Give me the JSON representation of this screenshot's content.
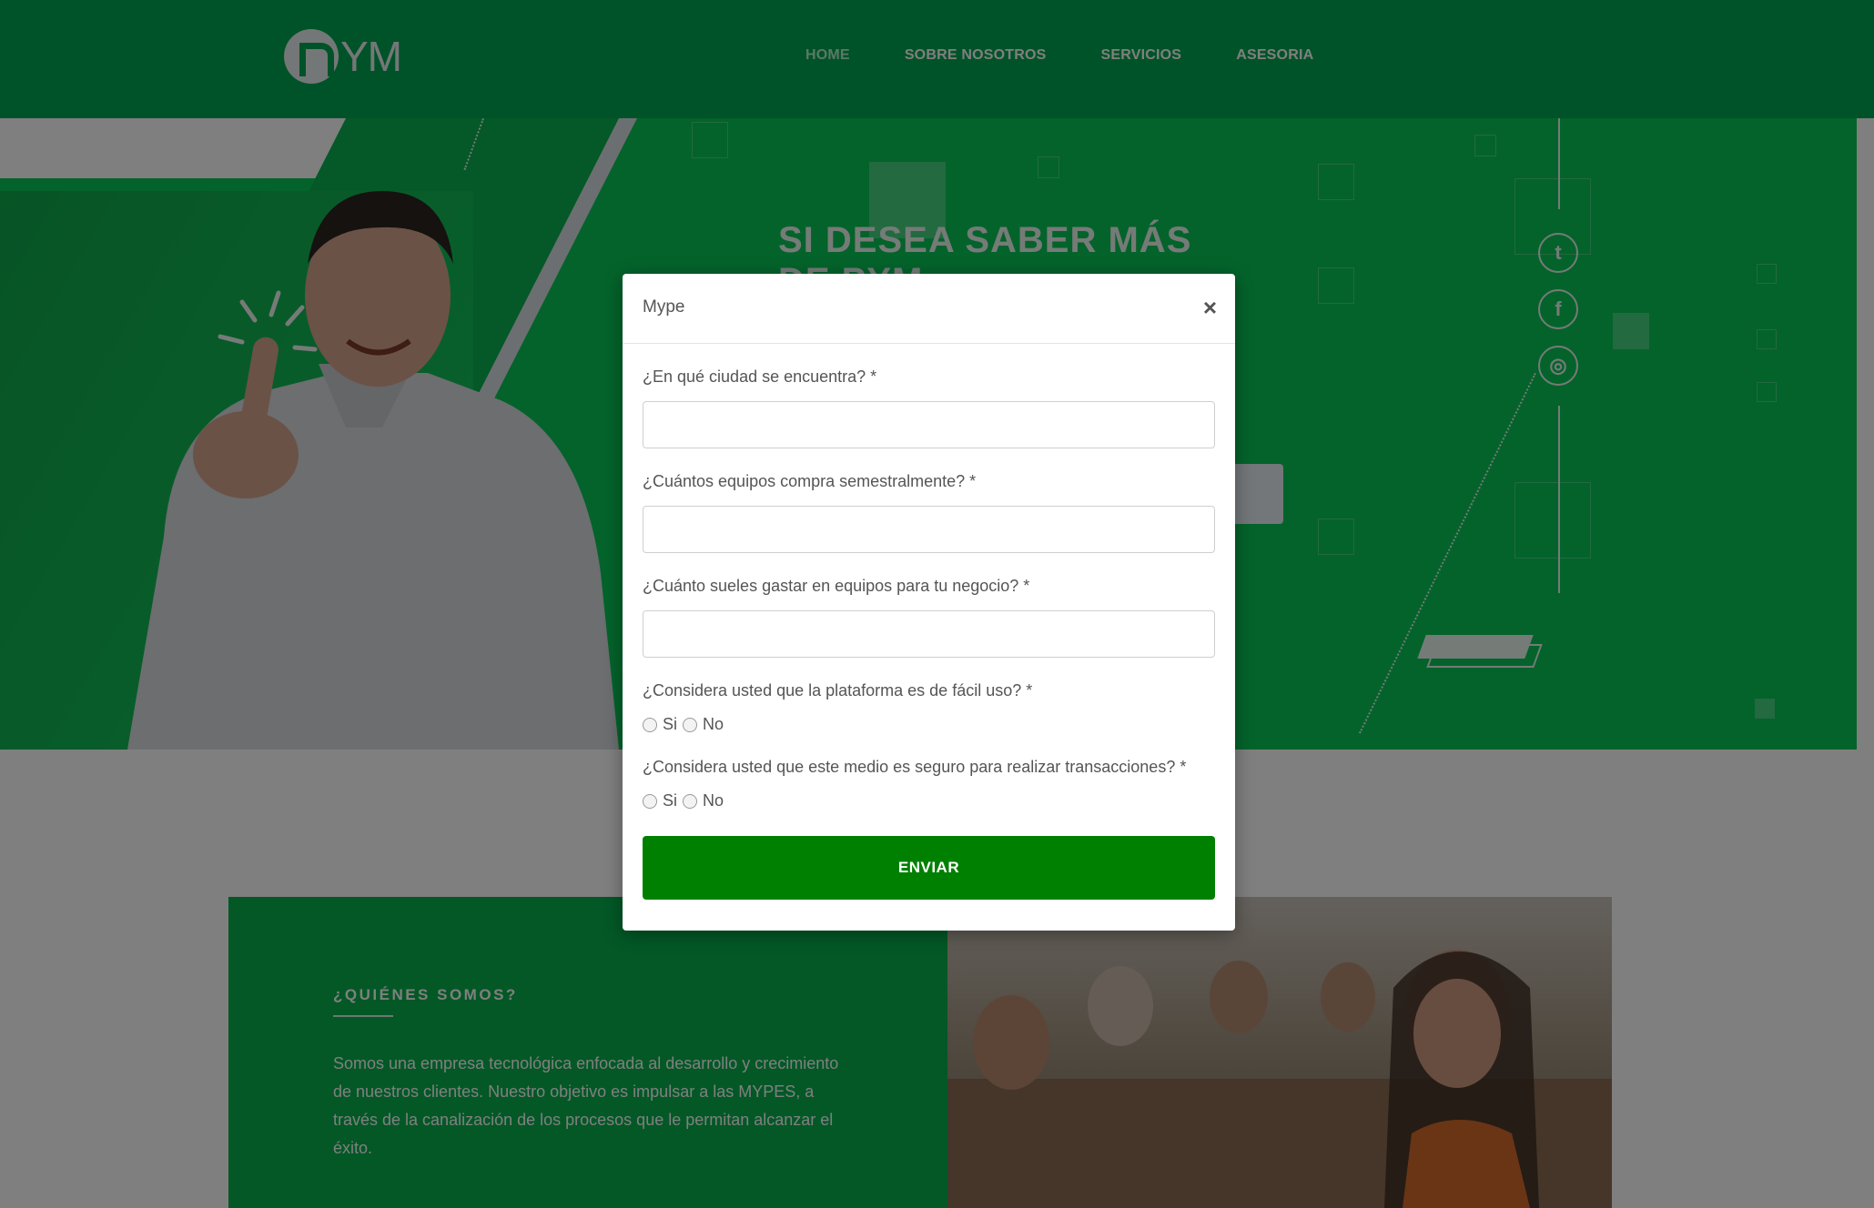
{
  "header": {
    "logo_text": "YM",
    "nav": [
      {
        "label": "HOME"
      },
      {
        "label": "SOBRE NOSOTROS"
      },
      {
        "label": "SERVICIOS"
      },
      {
        "label": "ASESORIA"
      }
    ]
  },
  "hero": {
    "title": "SI DESEA SABER MÁS DE PYM",
    "social_icons": [
      "twitter-icon",
      "facebook-icon",
      "instagram-icon"
    ]
  },
  "about": {
    "heading": "¿QUIÉNES SOMOS?",
    "text": "Somos una empresa tecnológica enfocada al desarrollo y crecimiento de nuestros clientes. Nuestro objetivo es impulsar a las MYPES, a través de la canalización de los procesos que le permitan alcanzar el éxito."
  },
  "modal": {
    "title": "Mype",
    "close_glyph": "×",
    "questions": [
      {
        "label": "¿En qué ciudad se encuentra? *",
        "value": ""
      },
      {
        "label": "¿Cuántos equipos compra semestralmente? *",
        "value": ""
      },
      {
        "label": "¿Cuánto sueles gastar en equipos para tu negocio? *",
        "value": ""
      }
    ],
    "radio_questions": [
      {
        "label": "¿Considera usted que la plataforma es de fácil uso? *",
        "options": [
          "Si",
          "No"
        ]
      },
      {
        "label": "¿Considera usted que este medio es seguro para realizar transacciones? *",
        "options": [
          "Si",
          "No"
        ]
      }
    ],
    "submit_label": "ENVIAR"
  },
  "colors": {
    "brand_green": "#00a651",
    "button_green": "#008000",
    "overlay": "rgba(0,0,0,0.5)"
  }
}
